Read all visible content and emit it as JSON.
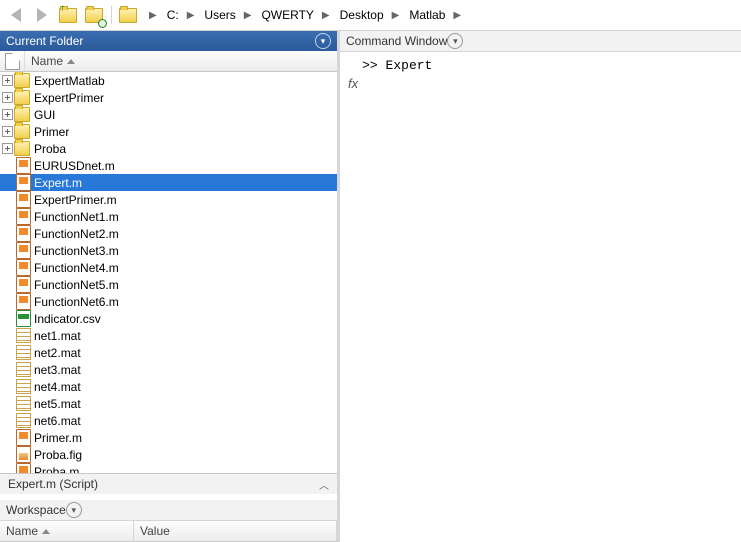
{
  "toolbar": {
    "back_icon": "back",
    "forward_icon": "forward",
    "up_icon": "folder-up",
    "browse_icon": "browse-folder"
  },
  "breadcrumbs": [
    "C:",
    "Users",
    "QWERTY",
    "Desktop",
    "Matlab"
  ],
  "panels": {
    "current_folder": {
      "title": "Current Folder",
      "column": "Name",
      "detail": "Expert.m  (Script)",
      "items": [
        {
          "name": "ExpertMatlab",
          "type": "folder",
          "expandable": true
        },
        {
          "name": "ExpertPrimer",
          "type": "folder",
          "expandable": true
        },
        {
          "name": "GUI",
          "type": "folder",
          "expandable": true
        },
        {
          "name": "Primer",
          "type": "folder",
          "expandable": true
        },
        {
          "name": "Proba",
          "type": "folder",
          "expandable": true
        },
        {
          "name": "EURUSDnet.m",
          "type": "m"
        },
        {
          "name": "Expert.m",
          "type": "m",
          "selected": true
        },
        {
          "name": "ExpertPrimer.m",
          "type": "m"
        },
        {
          "name": "FunctionNet1.m",
          "type": "m"
        },
        {
          "name": "FunctionNet2.m",
          "type": "m"
        },
        {
          "name": "FunctionNet3.m",
          "type": "m"
        },
        {
          "name": "FunctionNet4.m",
          "type": "m"
        },
        {
          "name": "FunctionNet5.m",
          "type": "m"
        },
        {
          "name": "FunctionNet6.m",
          "type": "m"
        },
        {
          "name": "Indicator.csv",
          "type": "csv"
        },
        {
          "name": "net1.mat",
          "type": "mat"
        },
        {
          "name": "net2.mat",
          "type": "mat"
        },
        {
          "name": "net3.mat",
          "type": "mat"
        },
        {
          "name": "net4.mat",
          "type": "mat"
        },
        {
          "name": "net5.mat",
          "type": "mat"
        },
        {
          "name": "net6.mat",
          "type": "mat"
        },
        {
          "name": "Primer.m",
          "type": "m"
        },
        {
          "name": "Proba.fig",
          "type": "fig"
        },
        {
          "name": "Proba.m",
          "type": "m"
        }
      ]
    },
    "workspace": {
      "title": "Workspace",
      "col_name": "Name",
      "col_value": "Value"
    },
    "command_window": {
      "title": "Command Window",
      "prompt": ">>",
      "input": "Expert",
      "fx_label": "fx"
    }
  }
}
